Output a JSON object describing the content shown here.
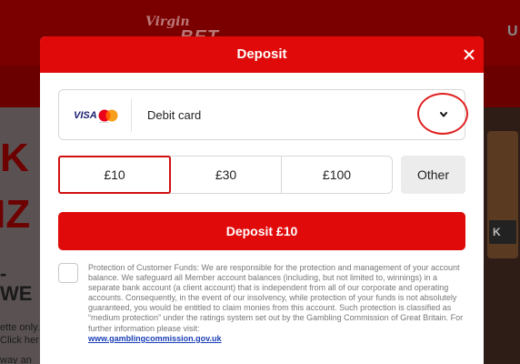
{
  "background": {
    "logo_small": "Virgin",
    "logo_big": "BET",
    "top_right": "U",
    "promo_big_1": "K",
    "promo_big_2": "IZ",
    "promo_big_3": "- WE",
    "promo_small_1": "ette only.",
    "promo_small_2": "Click her",
    "promo_small_3": "way an",
    "side_tag": "K"
  },
  "modal": {
    "title": "Deposit",
    "close_icon": "close-icon"
  },
  "payment_method": {
    "card_brand_visa": "VISA",
    "card_brand_mc_caption": "mastercard",
    "label": "Debit card",
    "dropdown_icon": "chevron-down-icon"
  },
  "amounts": {
    "options": [
      "£10",
      "£30",
      "£100"
    ],
    "selected": "£10",
    "other_label": "Other"
  },
  "deposit_button": {
    "label": "Deposit £10"
  },
  "protection": {
    "text": "Protection of Customer Funds: We are responsible for the protection and management of your account balance. We safeguard all Member account balances (including, but not limited to, winnings) in a separate bank account (a client account) that is independent from all of our corporate and operating accounts. Consequently, in the event of our insolvency, while protection of your funds is not absolutely guaranteed, you would be entitled to claim monies from this account. Such protection is classified as “medium protection” under the ratings system set out by the Gambling Commission of Great Britain. For further information please visit:",
    "link": "www.gamblingcommission.gov.uk"
  },
  "colors": {
    "brand_red": "#e10a0a",
    "selected_border": "#d01010",
    "link": "#1a3fb5"
  }
}
